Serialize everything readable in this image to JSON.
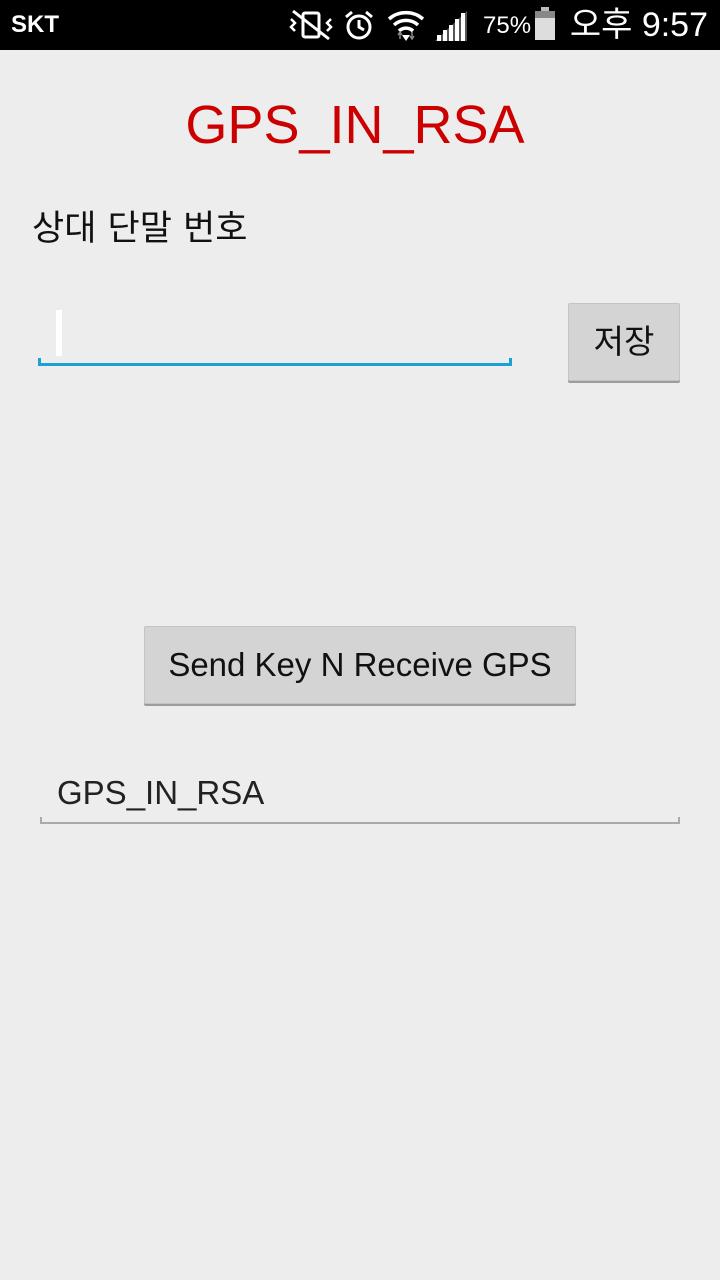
{
  "status_bar": {
    "carrier": "SKT",
    "battery_percent": "75%",
    "time": "오후 9:57",
    "icons": [
      "vibrate-mute-icon",
      "alarm-icon",
      "wifi-icon",
      "signal-icon",
      "battery-icon"
    ],
    "battery_level": 0.75
  },
  "main": {
    "title": "GPS_IN_RSA",
    "title_color": "#cc0000",
    "phone_label": "상대 단말 번호",
    "phone_input": {
      "value": "",
      "placeholder": ""
    },
    "save_label": "저장",
    "send_label": "Send Key N Receive GPS",
    "result_text": "GPS_IN_RSA"
  },
  "colors": {
    "background": "#ededed",
    "input_focus": "#1ba1d3",
    "button": "#d4d4d4"
  }
}
